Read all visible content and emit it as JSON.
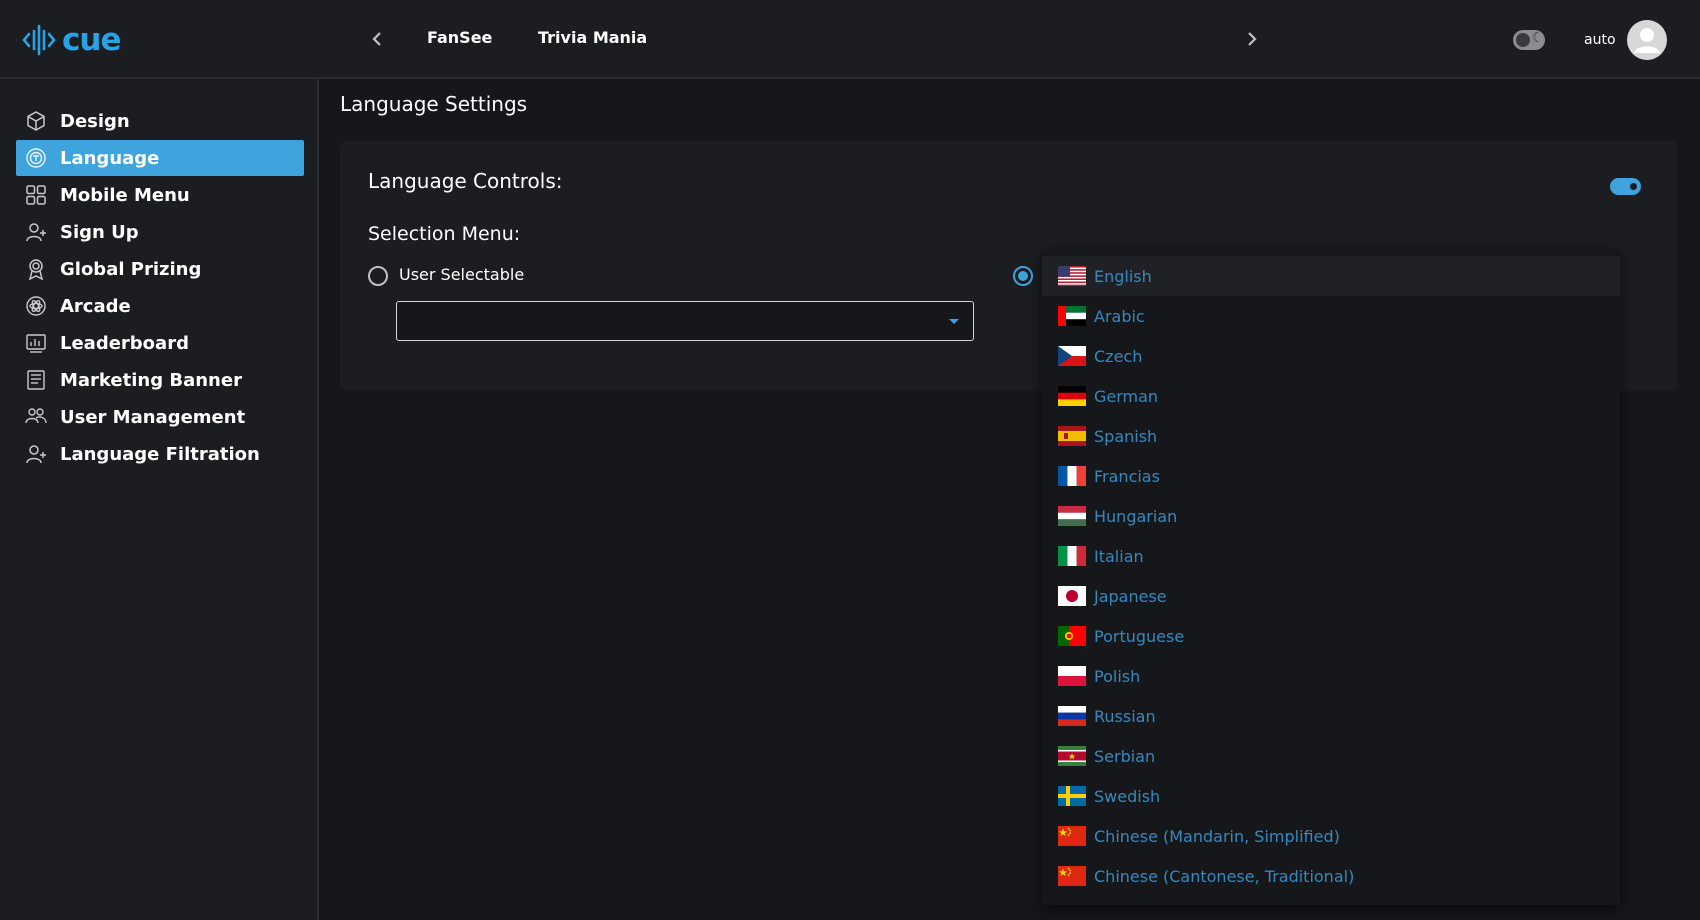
{
  "app": {
    "logo_text": "cue"
  },
  "header": {
    "tabs": [
      "FanSee",
      "Trivia Mania"
    ],
    "mode_label": "auto"
  },
  "sidebar": {
    "items": [
      {
        "label": "Design",
        "icon": "cube-icon",
        "active": false
      },
      {
        "label": "Language",
        "icon": "language-icon",
        "active": true
      },
      {
        "label": "Mobile Menu",
        "icon": "grid-icon",
        "active": false
      },
      {
        "label": "Sign Up",
        "icon": "user-add-icon",
        "active": false
      },
      {
        "label": "Global Prizing",
        "icon": "award-icon",
        "active": false
      },
      {
        "label": "Arcade",
        "icon": "atom-icon",
        "active": false
      },
      {
        "label": "Leaderboard",
        "icon": "chart-icon",
        "active": false
      },
      {
        "label": "Marketing Banner",
        "icon": "banner-icon",
        "active": false
      },
      {
        "label": "User Management",
        "icon": "users-icon",
        "active": false
      },
      {
        "label": "Language Filtration",
        "icon": "user-filter-icon",
        "active": false
      }
    ]
  },
  "main": {
    "title": "Language Settings",
    "controls_label": "Language Controls:",
    "controls_enabled": true,
    "selection_label": "Selection Menu:",
    "user_selectable_label": "User Selectable",
    "user_selectable_checked": false,
    "fixed_option_checked": true,
    "select_value": ""
  },
  "dropdown": {
    "highlighted": "English",
    "options": [
      "English",
      "Arabic",
      "Czech",
      "German",
      "Spanish",
      "Francias",
      "Hungarian",
      "Italian",
      "Japanese",
      "Portuguese",
      "Polish",
      "Russian",
      "Serbian",
      "Swedish",
      "Chinese (Mandarin, Simplified)",
      "Chinese (Cantonese, Traditional)"
    ]
  },
  "colors": {
    "accent": "#3fa3dd",
    "background": "#16171b",
    "panel": "#1c1d21",
    "dropdown_text": "#3788bb"
  }
}
